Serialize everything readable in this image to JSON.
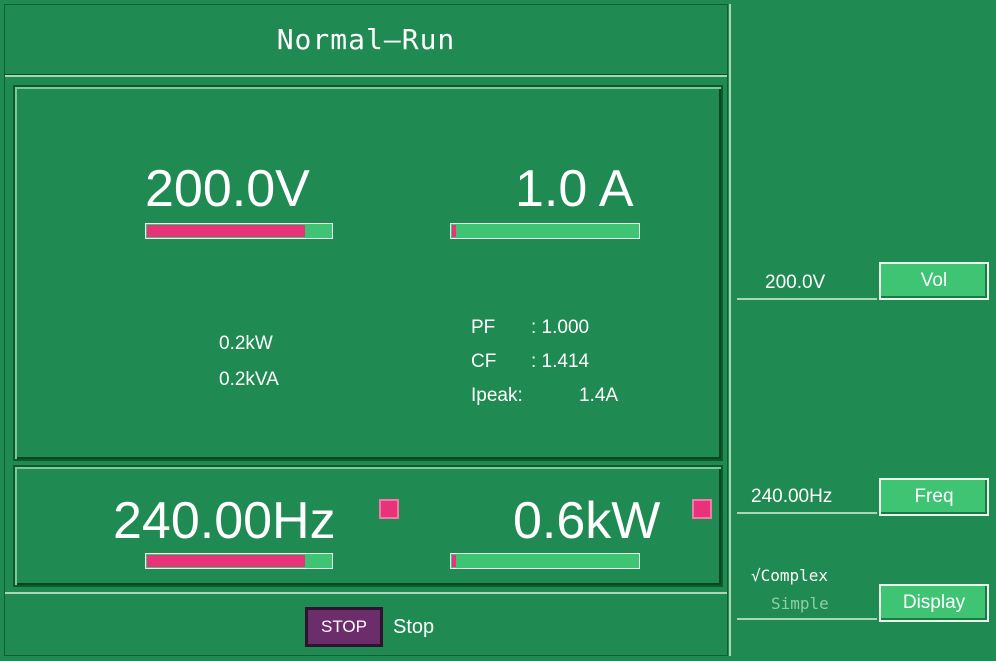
{
  "title": "Normal—Run",
  "readings": {
    "voltage": "200.0V",
    "current": "1.0 A",
    "frequency": "240.00Hz",
    "power": "0.6kW",
    "voltage_level": 0.86,
    "current_level": 0.03,
    "frequency_level": 0.86,
    "power_level": 0.03
  },
  "secondary": {
    "kw": "0.2kW",
    "kva": "0.2kVA",
    "pf_label": "PF",
    "pf_value": ": 1.000",
    "cf_label": "CF",
    "cf_value": ": 1.414",
    "ipeak_label": "Ipeak:",
    "ipeak_value": "1.4A"
  },
  "status": {
    "stop_button": "STOP",
    "state": "Stop"
  },
  "softkeys": {
    "voltage_value": "200.0V",
    "vol_button": "Vol",
    "frequency_value": "240.00Hz",
    "freq_button": "Freq",
    "display_button": "Display",
    "display_options": [
      {
        "label": "√Complex",
        "selected": true
      },
      {
        "label": "Simple",
        "selected": false
      }
    ]
  },
  "colors": {
    "background": "#1f8a52",
    "bar_fill": "#e8327a",
    "bar_track": "#3fc474",
    "stop_button": "#6b2e6a",
    "softkey": "#3fc474",
    "indicator": "#e8327a",
    "option_inactive": "#8fcfa6"
  }
}
